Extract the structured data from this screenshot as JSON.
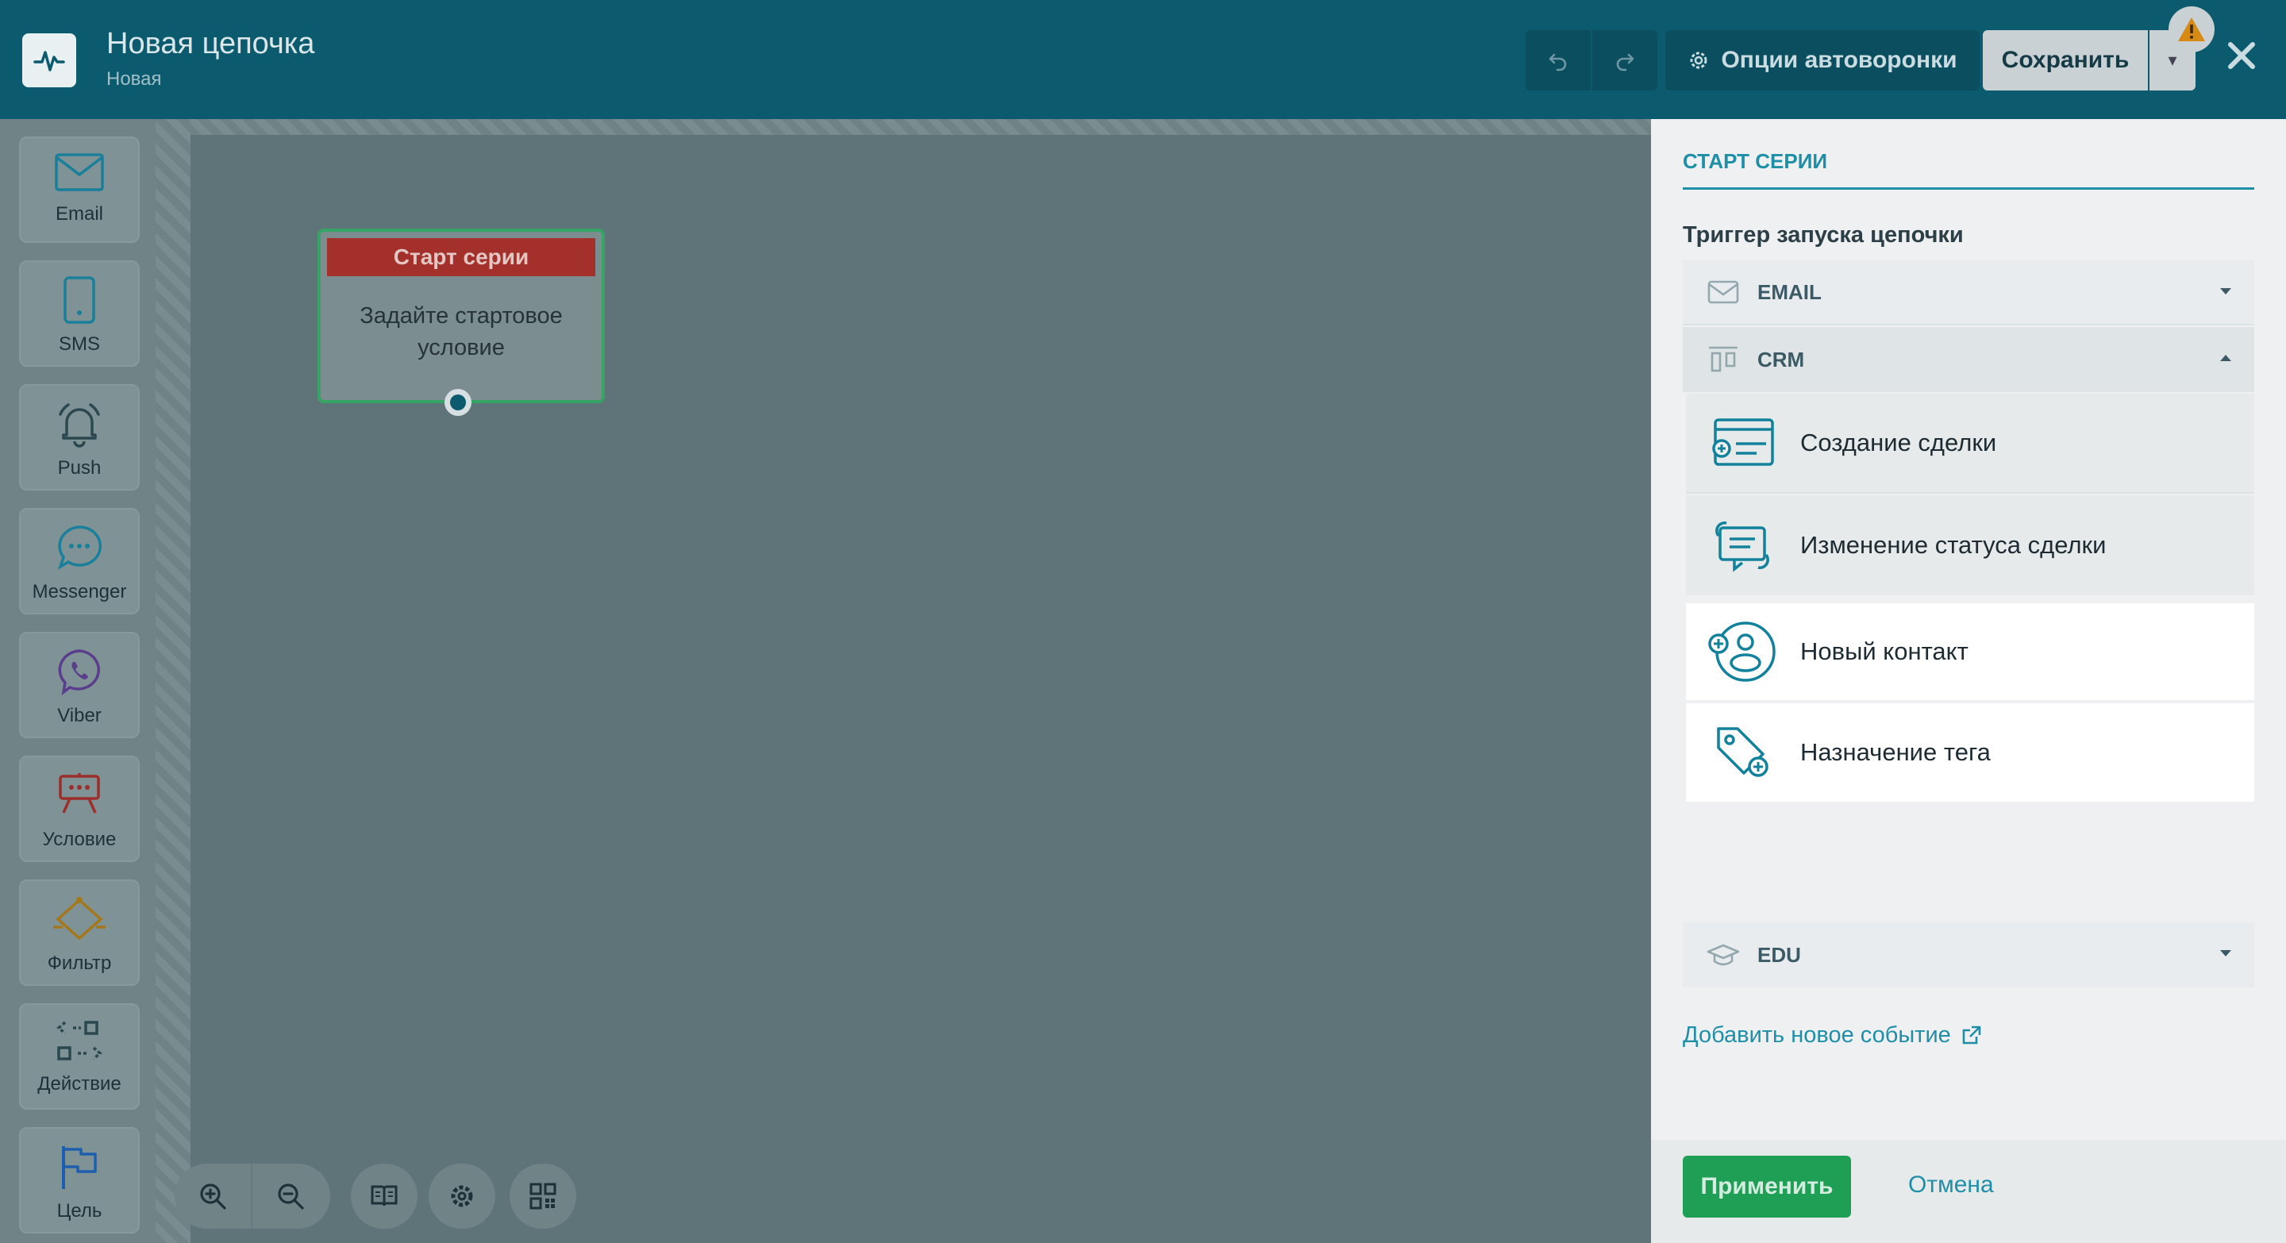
{
  "header": {
    "title": "Новая цепочка",
    "subtitle": "Новая",
    "options_label": "Опции автоворонки",
    "save_label": "Сохранить"
  },
  "palette": [
    {
      "label": "Email",
      "icon": "envelope-icon"
    },
    {
      "label": "SMS",
      "icon": "phone-icon"
    },
    {
      "label": "Push",
      "icon": "bell-icon"
    },
    {
      "label": "Messenger",
      "icon": "chat-icon"
    },
    {
      "label": "Viber",
      "icon": "viber-icon"
    },
    {
      "label": "Условие",
      "icon": "condition-icon"
    },
    {
      "label": "Фильтр",
      "icon": "filter-icon"
    },
    {
      "label": "Действие",
      "icon": "action-icon"
    },
    {
      "label": "Цель",
      "icon": "flag-icon"
    }
  ],
  "node": {
    "title": "Старт серии",
    "body": "Задайте стартовое условие"
  },
  "panel": {
    "tab": "СТАРТ СЕРИИ",
    "trigger_label": "Триггер запуска цепочки",
    "groups": {
      "email": "EMAIL",
      "crm": "CRM",
      "edu": "EDU"
    },
    "crm_options": [
      {
        "label": "Создание сделки",
        "icon": "deal-create-icon"
      },
      {
        "label": "Изменение статуса сделки",
        "icon": "deal-status-icon"
      },
      {
        "label": "Новый контакт",
        "icon": "new-contact-icon"
      },
      {
        "label": "Назначение тега",
        "icon": "tag-assign-icon"
      }
    ],
    "add_event": "Добавить новое событие",
    "apply": "Применить",
    "cancel": "Отмена"
  },
  "colors": {
    "header_bg": "#0b5a6e",
    "accent": "#1f8fa8",
    "apply_green": "#1f9e55",
    "node_head_red": "#a4302c",
    "node_border": "#35a464"
  }
}
